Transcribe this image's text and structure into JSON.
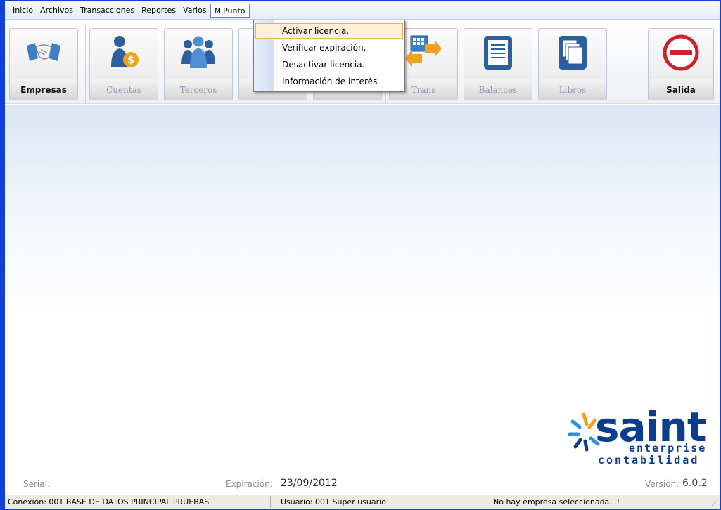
{
  "menubar": {
    "items": [
      {
        "label": "Inicio"
      },
      {
        "label": "Archivos"
      },
      {
        "label": "Transacciones"
      },
      {
        "label": "Reportes"
      },
      {
        "label": "Varios"
      },
      {
        "label": "MiPunto"
      }
    ]
  },
  "toolbar": {
    "buttons": [
      {
        "label": "Empresas",
        "enabled": true,
        "icon": "handshake-icon"
      },
      {
        "label": "Cuentas",
        "enabled": false,
        "icon": "person-money-icon"
      },
      {
        "label": "Terceros",
        "enabled": false,
        "icon": "people-group-icon"
      },
      {
        "label": "",
        "enabled": false,
        "icon": "hidden-icon"
      },
      {
        "label": "",
        "enabled": false,
        "icon": "hidden-icon"
      },
      {
        "label": "Trans",
        "enabled": false,
        "icon": "transactions-icon"
      },
      {
        "label": "Balances",
        "enabled": false,
        "icon": "document-icon"
      },
      {
        "label": "Libros",
        "enabled": false,
        "icon": "books-icon"
      },
      {
        "label": "Salida",
        "enabled": true,
        "icon": "exit-icon"
      }
    ]
  },
  "dropdown": {
    "items": [
      {
        "label": "Activar licencia."
      },
      {
        "label": "Verificar expiración."
      },
      {
        "label": "Desactivar licencia."
      },
      {
        "label": "Información de interés"
      }
    ]
  },
  "footer": {
    "serial_label": "Serial:",
    "expiration_label": "Expiración:",
    "expiration_value": "23/09/2012",
    "version_label": "Versión:",
    "version_value": "6.0.2"
  },
  "logo": {
    "word": "saint",
    "line1": "enterprise",
    "line2": "contabilidad"
  },
  "statusbar": {
    "connection": "Conexión:  001 BASE DE DATOS PRINCIPAL PRUEBAS",
    "user": "Usuario: 001 Super usuario",
    "company": "No hay empresa seleccionada...!"
  },
  "colors": {
    "frame": "#1140d8",
    "logo": "#0b3d8f",
    "highlight": "#fef1d4"
  }
}
